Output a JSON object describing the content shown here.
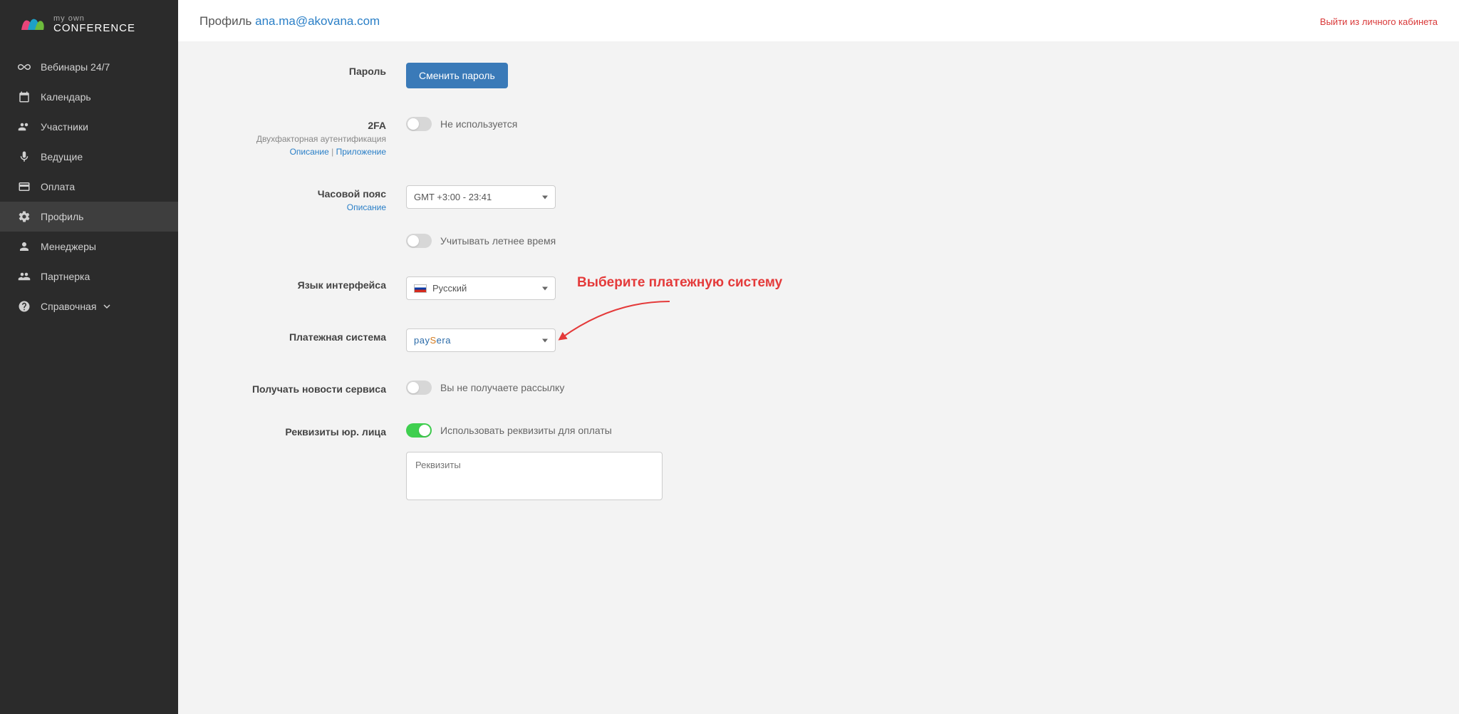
{
  "logo": {
    "top": "my own",
    "bottom": "CONFERENCE"
  },
  "nav": {
    "webinars": "Вебинары 24/7",
    "calendar": "Календарь",
    "participants": "Участники",
    "presenters": "Ведущие",
    "payment": "Оплата",
    "profile": "Профиль",
    "managers": "Менеджеры",
    "partner": "Партнерка",
    "help": "Справочная"
  },
  "header": {
    "profile_prefix": "Профиль ",
    "email": "ana.ma@akovana.com",
    "logout": "Выйти из личного кабинета"
  },
  "form": {
    "password": {
      "label": "Пароль",
      "button": "Сменить пароль"
    },
    "twofa": {
      "label": "2FA",
      "sub": "Двухфакторная аутентификация",
      "desc_link": "Описание",
      "app_link": "Приложение",
      "sep": " | ",
      "status": "Не используется"
    },
    "timezone": {
      "label": "Часовой пояс",
      "desc_link": "Описание",
      "value": "GMT +3:00 - 23:41",
      "dst_label": "Учитывать летнее время"
    },
    "language": {
      "label": "Язык интерфейса",
      "value": "Русский"
    },
    "payment_system": {
      "label": "Платежная система",
      "value_p1": "pay",
      "value_p2": "S",
      "value_p3": "era",
      "callout": "Выберите платежную систему"
    },
    "newsletter": {
      "label": "Получать новости сервиса",
      "status": "Вы не получаете рассылку"
    },
    "company": {
      "label": "Реквизиты юр. лица",
      "toggle_label": "Использовать реквизиты для оплаты",
      "placeholder": "Реквизиты"
    }
  }
}
